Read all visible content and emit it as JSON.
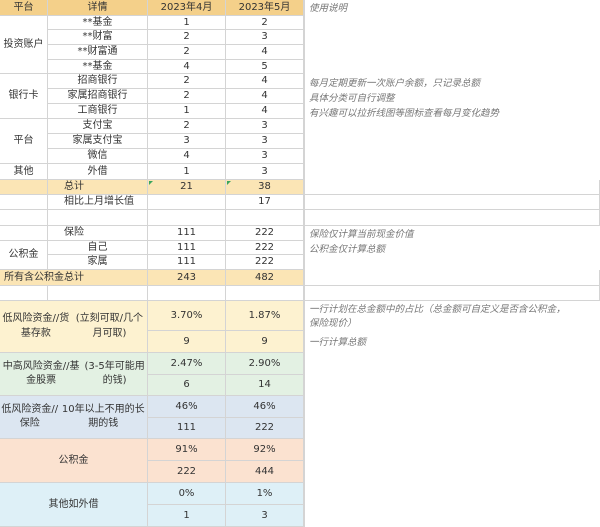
{
  "header": {
    "platform": "平台",
    "detail": "详情",
    "apr": "2023年4月",
    "may": "2023年5月",
    "notes": "使用说明"
  },
  "groups": {
    "invest": "投资账户",
    "bank": "银行卡",
    "platform": "平台",
    "other": "其他",
    "gjj": "公积金"
  },
  "rows": [
    {
      "detail": "**基金",
      "apr": "1",
      "may": "2"
    },
    {
      "detail": "**财富",
      "apr": "2",
      "may": "3"
    },
    {
      "detail": "**财富通",
      "apr": "2",
      "may": "4"
    },
    {
      "detail": "**基金",
      "apr": "4",
      "may": "5"
    },
    {
      "detail": "招商银行",
      "apr": "2",
      "may": "4"
    },
    {
      "detail": "家属招商银行",
      "apr": "2",
      "may": "4"
    },
    {
      "detail": "工商银行",
      "apr": "1",
      "may": "4"
    },
    {
      "detail": "支付宝",
      "apr": "2",
      "may": "3"
    },
    {
      "detail": "家属支付宝",
      "apr": "3",
      "may": "3"
    },
    {
      "detail": "微信",
      "apr": "4",
      "may": "3"
    },
    {
      "detail": "外借",
      "apr": "1",
      "may": "3"
    }
  ],
  "total": {
    "label": "总计",
    "apr": "21",
    "may": "38"
  },
  "growth": {
    "label": "相比上月增长值",
    "may": "17"
  },
  "insurance": {
    "detail": "保险",
    "apr": "111",
    "may": "222"
  },
  "gjj_self": {
    "detail": "自己",
    "apr": "111",
    "may": "222"
  },
  "gjj_family": {
    "detail": "家属",
    "apr": "111",
    "may": "222"
  },
  "grand_total": {
    "label": "所有含公积金总计",
    "apr": "243",
    "may": "482"
  },
  "categories": [
    {
      "line1": "低风险资金//货基存款",
      "line2": "(立刻可取/几个月可取)",
      "pct_apr": "3.70%",
      "pct_may": "1.87%",
      "amt_apr": "9",
      "amt_may": "9"
    },
    {
      "line1": "中高风险资金//基金股票",
      "line2": "(3-5年可能用的钱)",
      "pct_apr": "2.47%",
      "pct_may": "2.90%",
      "amt_apr": "6",
      "amt_may": "14"
    },
    {
      "line1": "低风险资金//保险",
      "line2": "10年以上不用的长期的钱",
      "pct_apr": "46%",
      "pct_may": "46%",
      "amt_apr": "111",
      "amt_may": "222"
    },
    {
      "line1": "公积金",
      "line2": "",
      "pct_apr": "91%",
      "pct_may": "92%",
      "amt_apr": "222",
      "amt_may": "444"
    },
    {
      "line1": "其他如外借",
      "line2": "",
      "pct_apr": "0%",
      "pct_may": "1%",
      "amt_apr": "1",
      "amt_may": "3"
    }
  ],
  "notes": {
    "n1": "每月定期更新一次账户余额，只记录总额",
    "n2": "具体分类可自行调整",
    "n3": "有兴趣可以拉折线图等图标查看每月变化趋势",
    "n4": "保险仅计算当前现金价值",
    "n5": "公积金仅计算总额",
    "n6a": "一行计划在总金额中的占比（总金额可自定义是否含公积金，",
    "n6b": "保险现价）",
    "n7": "一行计算总额"
  },
  "colors": {
    "header": "#f4d08a",
    "sum": "#fbe5b5",
    "yellow": "#fdf2d0",
    "green": "#e3f1e3",
    "blue": "#dce6f1",
    "peach": "#fbe2d0",
    "light_blue": "#def0f7",
    "triangle": "#3aa55d"
  }
}
